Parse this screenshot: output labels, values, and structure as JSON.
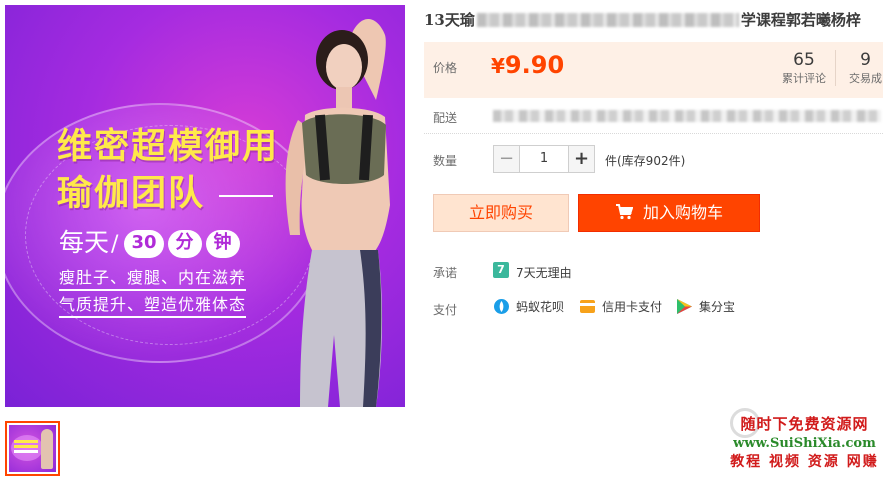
{
  "banner": {
    "title_line1": "维密超模御用",
    "title_line2": "瑜伽团队",
    "daily": "每天",
    "pills": [
      "30",
      "分",
      "钟"
    ],
    "sub_line1": "瘦肚子、瘦腿、内在滋养",
    "sub_line2": "气质提升、塑造优雅体态"
  },
  "product": {
    "title_start": "13天瑜",
    "title_end": "学课程郭若曦杨梓"
  },
  "price": {
    "label": "价格",
    "currency": "¥",
    "value": "9.90",
    "reviews_count": "65",
    "reviews_label": "累计评论",
    "deals_count": "9",
    "deals_label": "交易成"
  },
  "shipping": {
    "label": "配送"
  },
  "quantity": {
    "label": "数量",
    "minus": "−",
    "value": "1",
    "plus": "+",
    "stock": "件(库存902件)"
  },
  "actions": {
    "buy_now": "立即购买",
    "add_to_cart": "加入购物车"
  },
  "promise": {
    "label": "承诺",
    "badge": "7",
    "text": "7天无理由"
  },
  "payment": {
    "label": "支付",
    "methods": [
      {
        "name": "蚂蚁花呗",
        "icon": "huabei-icon",
        "color": "#1a9ee8"
      },
      {
        "name": "信用卡支付",
        "icon": "credit-card-icon",
        "color": "#f7a21b"
      },
      {
        "name": "集分宝",
        "icon": "jifenbao-icon",
        "color": "#3a9ce8"
      }
    ]
  },
  "watermark": {
    "line1": "随时下免费资源网",
    "line2": "www.SuiShiXia.com",
    "line3": "教程 视频 资源 网赚"
  },
  "colors": {
    "accent": "#ff4400",
    "price_bg": "#fef0e6",
    "banner_purple": "#a52be0",
    "banner_yellow": "#ffe94a"
  }
}
